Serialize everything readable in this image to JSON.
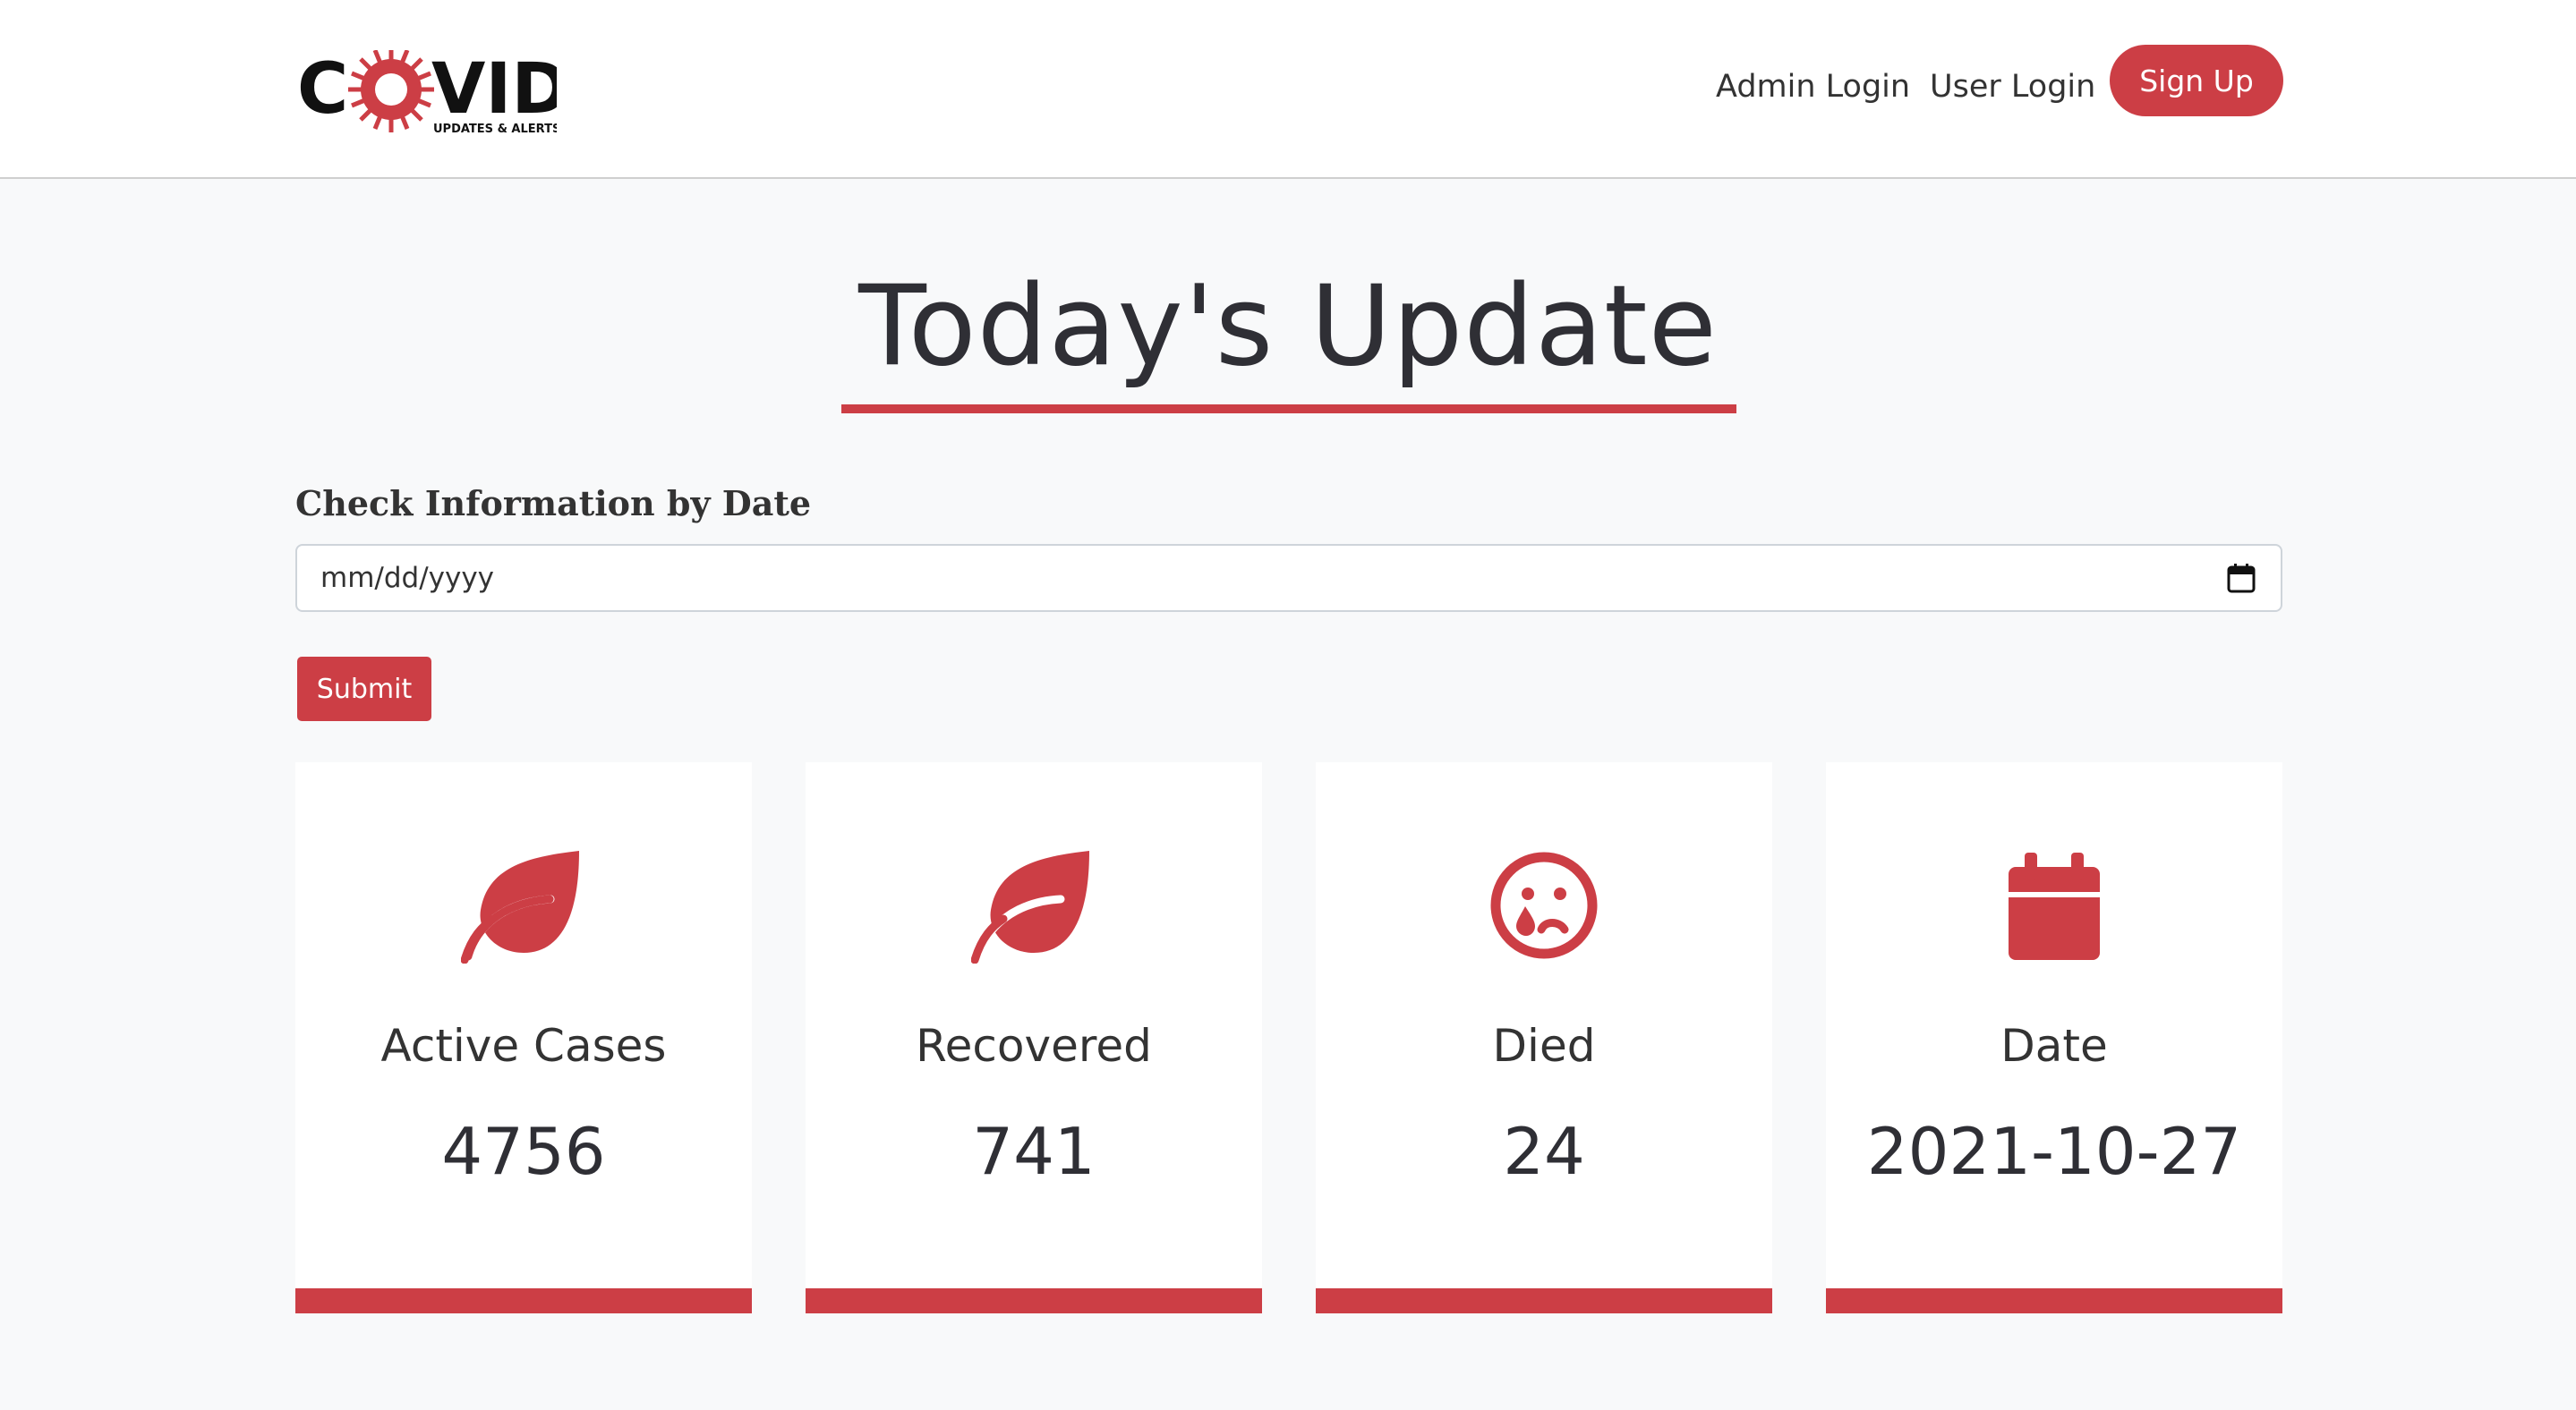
{
  "brand": {
    "logo_text": "COVID",
    "logo_tagline": "UPDATES & ALERTS",
    "accent_color": "#cc3e45"
  },
  "nav": {
    "admin_login": "Admin Login",
    "user_login": "User Login",
    "sign_up": "Sign Up"
  },
  "page": {
    "title": "Today's Update"
  },
  "date_form": {
    "label": "Check Information by Date",
    "placeholder": "mm/dd/yyyy",
    "value": "",
    "submit_label": "Submit",
    "calendar_icon": "calendar-icon"
  },
  "stats": [
    {
      "icon": "leaf-icon",
      "label": "Active Cases",
      "value": "4756"
    },
    {
      "icon": "leaf-icon",
      "label": "Recovered",
      "value": "741"
    },
    {
      "icon": "sad-tear-face-icon",
      "label": "Died",
      "value": "24"
    },
    {
      "icon": "calendar-icon",
      "label": "Date",
      "value": "2021-10-27"
    }
  ]
}
